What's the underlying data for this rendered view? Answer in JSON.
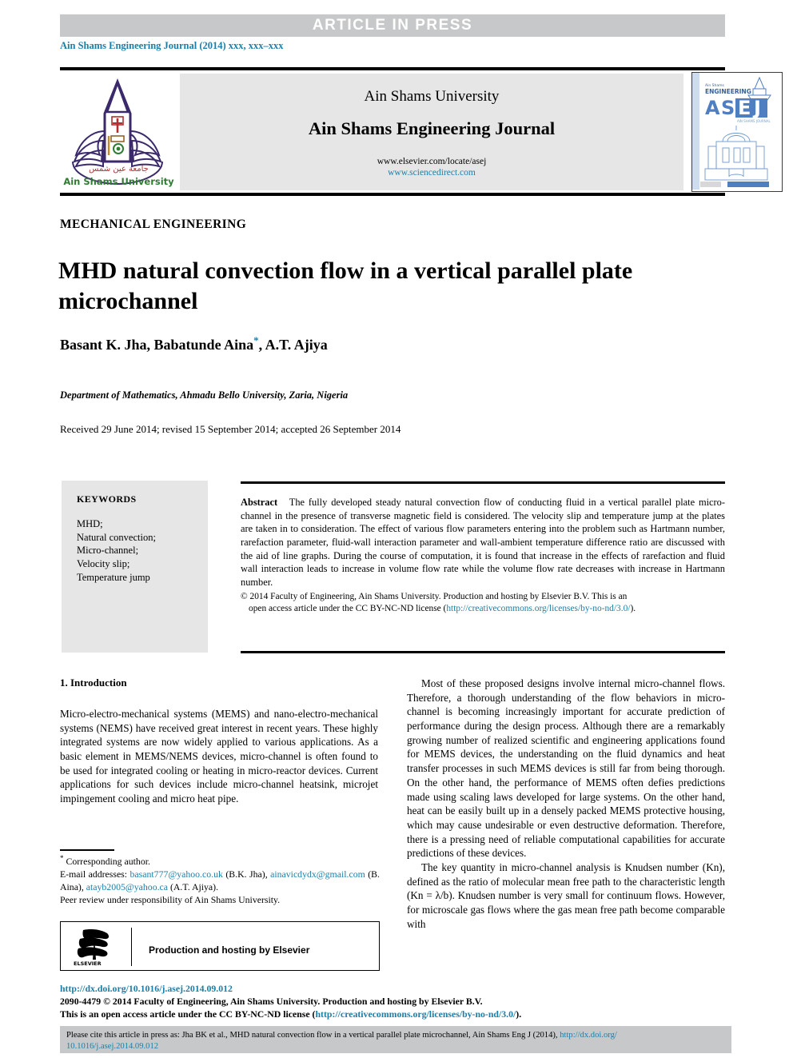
{
  "banner": {
    "label": "ARTICLE  IN  PRESS"
  },
  "running_head": "Ain Shams Engineering Journal (2014) xxx, xxx–xxx",
  "masthead": {
    "university": "Ain Shams University",
    "journal": "Ain Shams Engineering Journal",
    "url_elsevier": "www.elsevier.com/locate/asej",
    "url_sciencedirect": "www.sciencedirect.com",
    "logo_caption_arabic": "جامعة عين شمس",
    "logo_caption": "Ain Shams University",
    "cover": {
      "top_small": "Ain Shams",
      "top_word": "ENGINEERING",
      "acronym_a": "A",
      "acronym_s": "S",
      "acronym_e": "E",
      "acronym_j": "J",
      "subtitle": "AIN SHAMS JOURNAL"
    }
  },
  "article": {
    "kicker": "MECHANICAL ENGINEERING",
    "title": "MHD natural convection flow in a vertical parallel plate microchannel",
    "authors": "Basant K. Jha, Babatunde Aina",
    "authors_tail": ", A.T. Ajiya",
    "corresponding_marker": "*",
    "affiliation": "Department of Mathematics, Ahmadu Bello University, Zaria, Nigeria",
    "history": "Received 29 June 2014; revised 15 September 2014; accepted 26 September 2014"
  },
  "keywords": {
    "heading": "KEYWORDS",
    "items": [
      "MHD;",
      "Natural convection;",
      "Micro-channel;",
      "Velocity slip;",
      "Temperature jump"
    ]
  },
  "abstract": {
    "label": "Abstract",
    "text": "The fully developed steady natural convection flow of conducting fluid in a vertical parallel plate micro-channel in the presence of transverse magnetic field is considered. The velocity slip and temperature jump at the plates are taken in to consideration. The effect of various flow parameters entering into the problem such as Hartmann number, rarefaction parameter, fluid-wall interaction parameter and wall-ambient temperature difference ratio are discussed with the aid of line graphs. During the course of computation, it is found that increase in the effects of rarefaction and fluid wall interaction leads to increase in volume flow rate while the volume flow rate decreases with increase in Hartmann number.",
    "copyright_a": "© 2014 Faculty of Engineering, Ain Shams University. Production and hosting by Elsevier B.V. This is an",
    "copyright_b": "open access article under the CC BY-NC-ND license (",
    "copyright_link": "http://creativecommons.org/licenses/by-no-nd/3.0/",
    "copyright_c": ")."
  },
  "body": {
    "section_heading": "1. Introduction",
    "left_paragraphs": [
      "Micro-electro-mechanical systems (MEMS) and nano-electro-mechanical systems (NEMS) have received great interest in recent years. These highly integrated systems are now widely applied to various applications. As a basic element in MEMS/NEMS devices, micro-channel is often found to be used for integrated cooling or heating in micro-reactor devices. Current applications for such devices include micro-channel heatsink, microjet impingement cooling and micro heat pipe."
    ],
    "right_paragraphs": [
      "Most of these proposed designs involve internal micro-channel flows. Therefore, a thorough understanding of the flow behaviors in micro-channel is becoming increasingly important for accurate prediction of performance during the design process. Although there are a remarkably growing number of realized scientific and engineering applications found for MEMS devices, the understanding on the fluid dynamics and heat transfer processes in such MEMS devices is still far from being thorough. On the other hand, the performance of MEMS often defies predictions made using scaling laws developed for large systems. On the other hand, heat can be easily built up in a densely packed MEMS protective housing, which may cause undesirable or even destructive deformation. Therefore, there is a pressing need of reliable computational capabilities for accurate predictions of these devices.",
      "The key quantity in micro-channel analysis is Knudsen number (Kn), defined as the ratio of molecular mean free path to the characteristic length (Kn = λ/b). Knudsen number is very small for continuum flows. However, for microscale gas flows where the gas mean free path become comparable with"
    ]
  },
  "footnote": {
    "corresponding": "Corresponding author.",
    "email_label": "E-mail addresses:",
    "email_1": "basant777@yahoo.co.uk",
    "email_1_owner": "(B.K. Jha),",
    "email_2": "ainavicdydx@gmail.com",
    "email_2_owner": "(B. Aina),",
    "email_3": "atayb2005@yahoo.ca",
    "email_3_owner": "(A.T. Ajiya).",
    "peer_review": "Peer review under responsibility of Ain Shams University."
  },
  "elsevier_box": {
    "logo_label": "ELSEVIER",
    "text": "Production and hosting by Elsevier"
  },
  "doi_block": {
    "doi": "http://dx.doi.org/10.1016/j.asej.2014.09.012",
    "issn_line": "2090-4479 © 2014 Faculty of Engineering, Ain Shams University. Production and hosting by Elsevier B.V.",
    "license_prefix": "This is an open access article under the CC BY-NC-ND license (",
    "license_link": "http://creativecommons.org/licenses/by-no-nd/3.0/",
    "license_suffix": ")."
  },
  "cite_box": {
    "text": "Please cite this article in press as: Jha BK et al., MHD natural convection flow in a vertical parallel plate microchannel, Ain Shams Eng J (2014), ",
    "link_a": "http://dx.doi.org/",
    "link_b": "10.1016/j.asej.2014.09.012"
  },
  "colors": {
    "link_blue": "#1a7fa8",
    "band_gray": "#c7c8c9",
    "panel_gray": "#e6e6e6",
    "logo_purple": "#3b2a6b",
    "cover_blue": "#4f7fc0"
  }
}
